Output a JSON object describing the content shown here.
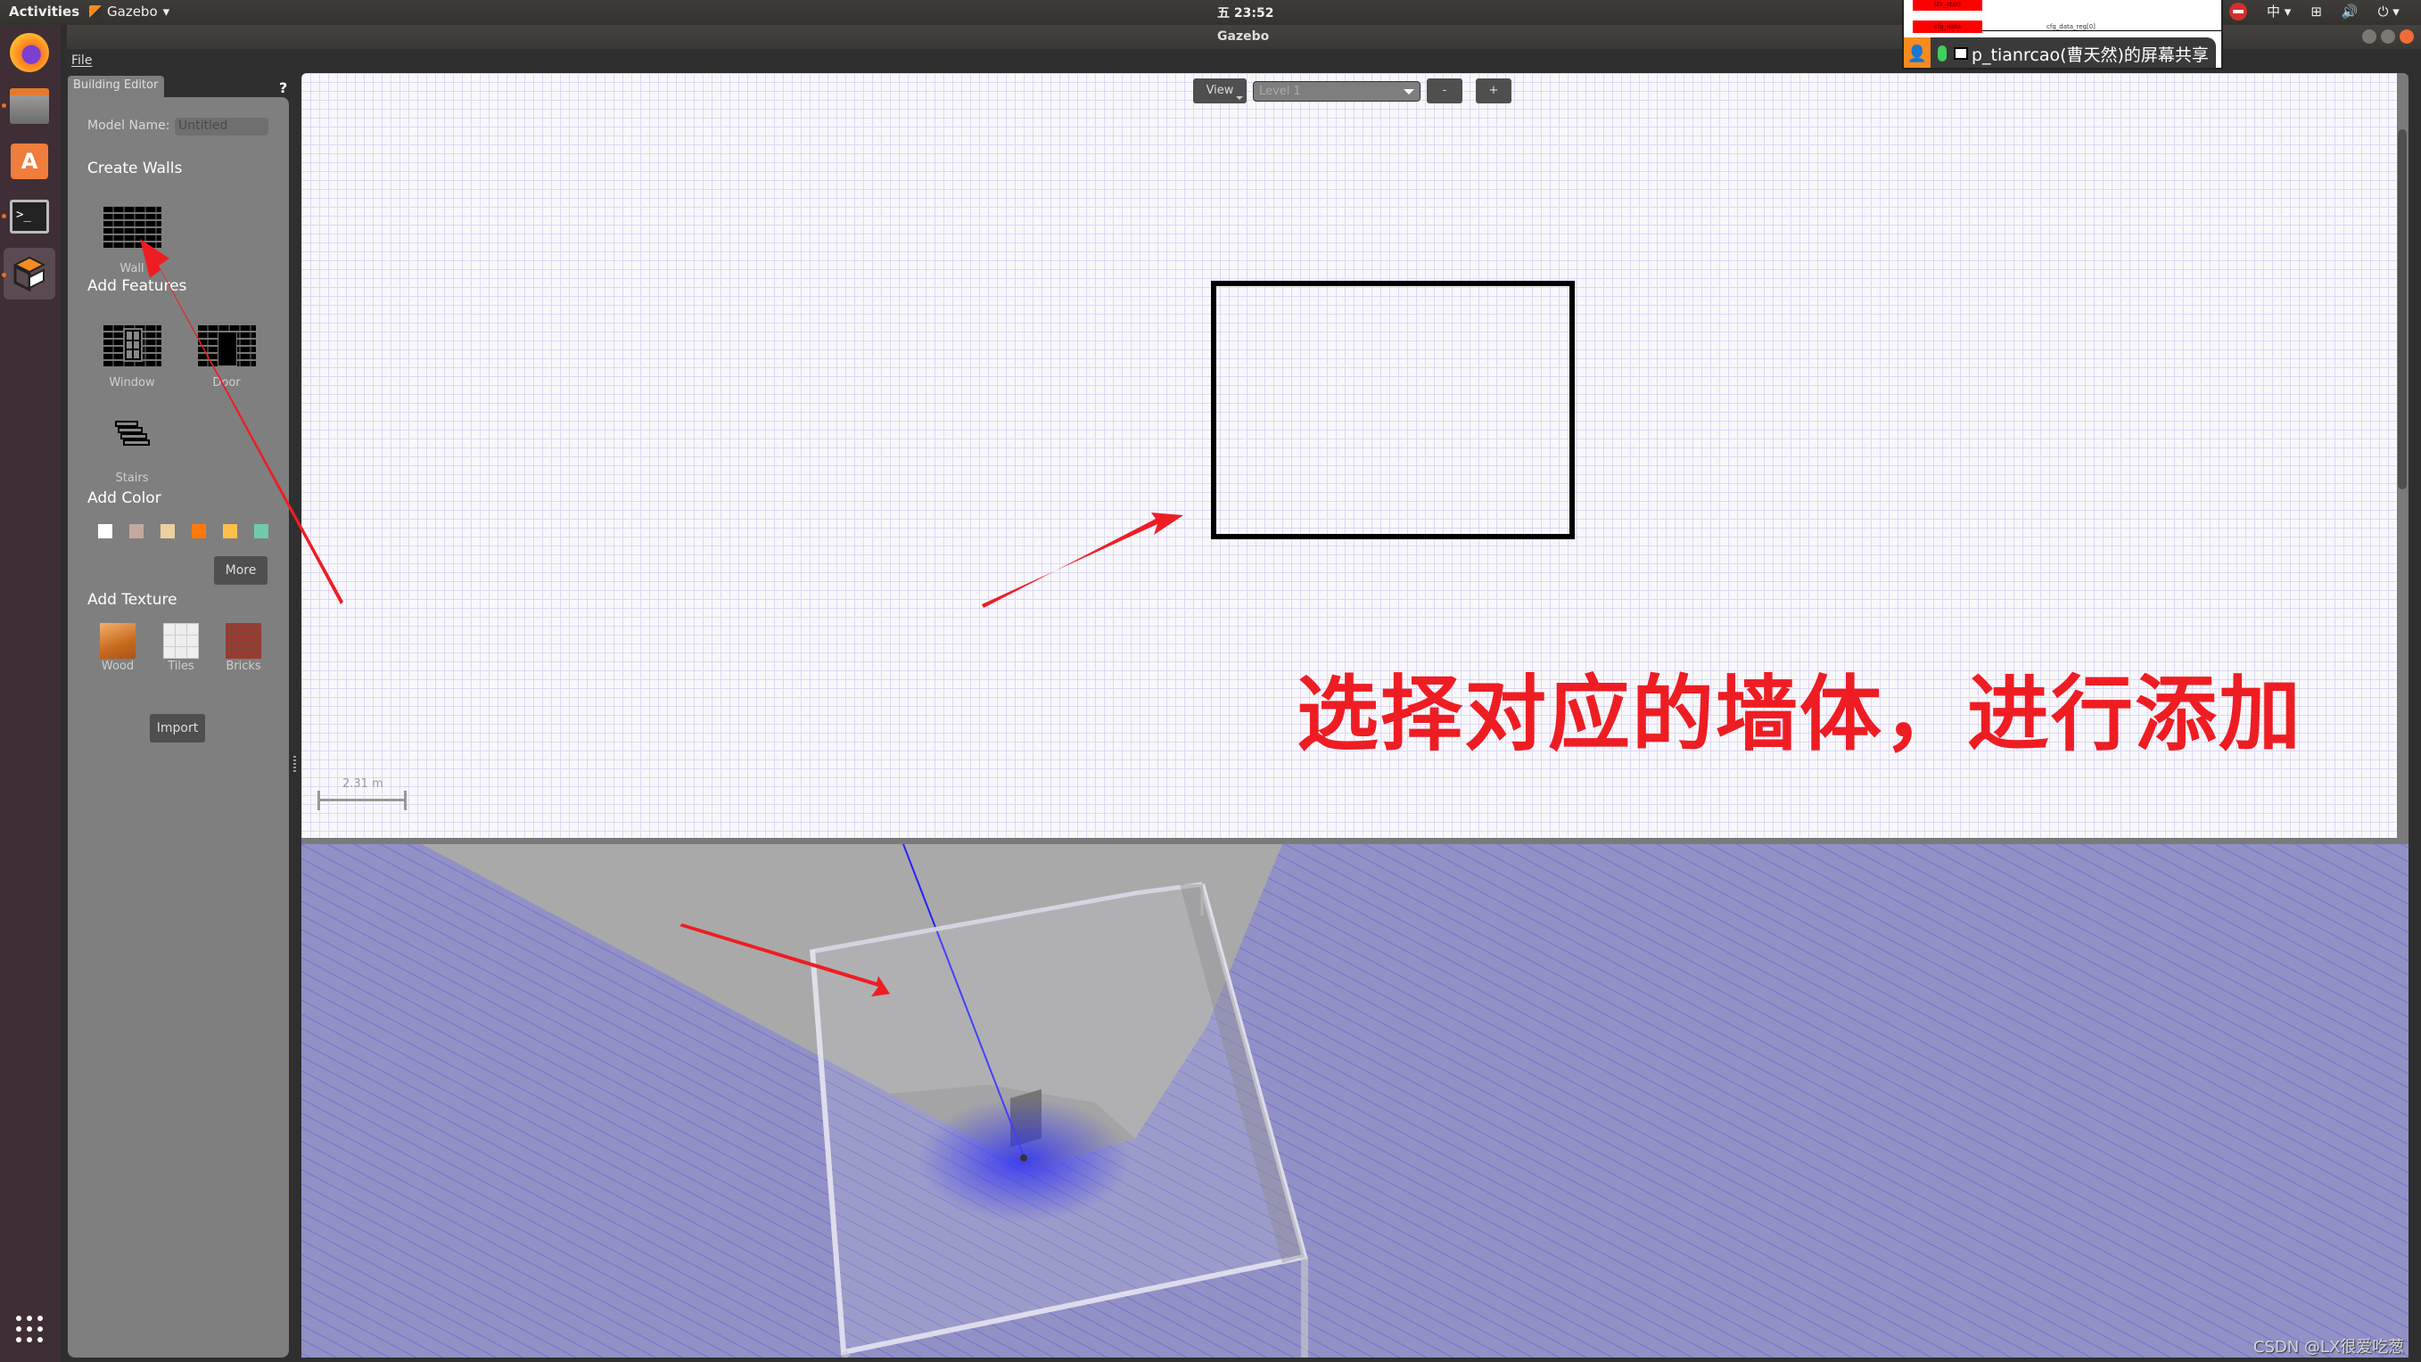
{
  "topbar": {
    "activities": "Activities",
    "app_name": "Gazebo",
    "clock": "五 23:52",
    "input_method": "中",
    "icons": [
      "do-not-disturb-icon",
      "network-icon",
      "volume-icon",
      "power-icon"
    ]
  },
  "window": {
    "title": "Gazebo"
  },
  "dock": {
    "items": [
      {
        "name": "firefox",
        "icon": "firefox-icon"
      },
      {
        "name": "files",
        "icon": "file-cabinet-icon"
      },
      {
        "name": "ubuntu-software",
        "icon": "shopping-bag-icon",
        "glyph": "A"
      },
      {
        "name": "terminal",
        "icon": "terminal-icon",
        "glyph": ">_"
      },
      {
        "name": "gazebo",
        "icon": "gazebo-icon",
        "active": true
      }
    ],
    "show_apps_icon": "app-grid-icon"
  },
  "menubar": {
    "file": "File"
  },
  "building_editor": {
    "tab": "Building Editor",
    "help": "?",
    "model_name_label": "Model Name:",
    "model_name_value": "Untitled",
    "create_walls": "Create Walls",
    "wall_label": "Wall",
    "add_features": "Add Features",
    "window_label": "Window",
    "door_label": "Door",
    "stairs_label": "Stairs",
    "add_color": "Add Color",
    "colors": [
      "#ffffff",
      "#c4a8a0",
      "#ecd0a0",
      "#ff7a0a",
      "#ffc04a",
      "#6ecaaa"
    ],
    "more_button": "More",
    "add_texture": "Add Texture",
    "textures": [
      "Wood",
      "Tiles",
      "Bricks"
    ],
    "import_button": "Import"
  },
  "view2d": {
    "view_button": "View",
    "level_select": "Level 1",
    "zoom_out": "-",
    "zoom_in": "+",
    "scale_label": "2.31 m"
  },
  "annotation": {
    "text": "选择对应的墙体，进行添加",
    "color": "#ee1d23"
  },
  "screen_share": {
    "text": "p_tianrcao(曹天然)的屏幕共享",
    "bg_labels": [
      "i2c_start",
      "cfg_data",
      "cfg_data_reg[0]"
    ]
  },
  "watermark": "CSDN @LX很爱吃葱"
}
